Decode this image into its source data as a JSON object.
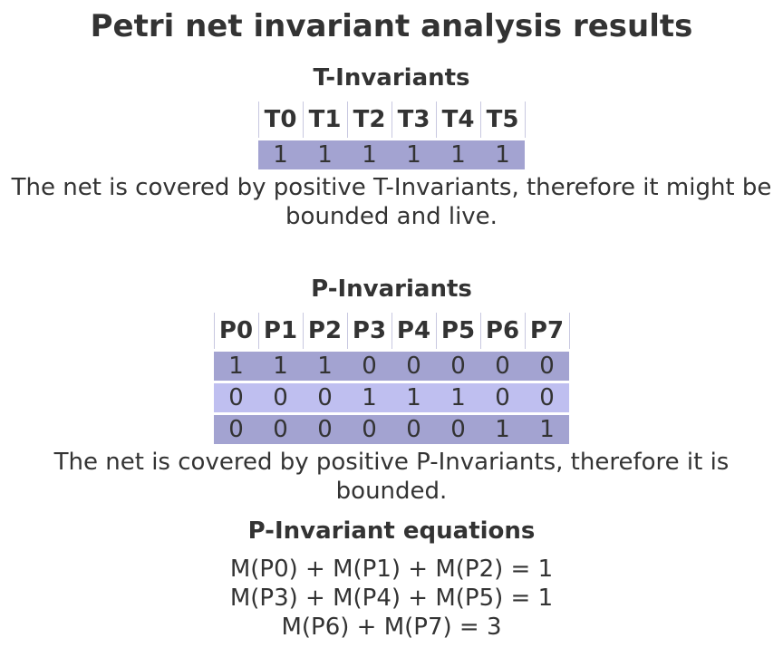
{
  "title": "Petri net invariant analysis results",
  "t_invariants": {
    "heading": "T-Invariants",
    "columns": [
      "T0",
      "T1",
      "T2",
      "T3",
      "T4",
      "T5"
    ],
    "rows": [
      [
        "1",
        "1",
        "1",
        "1",
        "1",
        "1"
      ]
    ],
    "conclusion": "The net is covered by positive T-Invariants, therefore it might be bounded and live.",
    "row_color": "#a3a3d1"
  },
  "p_invariants": {
    "heading": "P-Invariants",
    "columns": [
      "P0",
      "P1",
      "P2",
      "P3",
      "P4",
      "P5",
      "P6",
      "P7"
    ],
    "rows": [
      [
        "1",
        "1",
        "1",
        "0",
        "0",
        "0",
        "0",
        "0"
      ],
      [
        "0",
        "0",
        "0",
        "1",
        "1",
        "1",
        "0",
        "0"
      ],
      [
        "0",
        "0",
        "0",
        "0",
        "0",
        "0",
        "1",
        "1"
      ]
    ],
    "conclusion": "The net is covered by positive P-Invariants, therefore it is bounded.",
    "row_colors": [
      "#a3a3d1",
      "#bfbff0"
    ]
  },
  "equations": {
    "heading": "P-Invariant equations",
    "items": [
      "M(P0) + M(P1) + M(P2) = 1",
      "M(P3) + M(P4) + M(P5) = 1",
      "M(P6) + M(P7) = 3"
    ]
  }
}
